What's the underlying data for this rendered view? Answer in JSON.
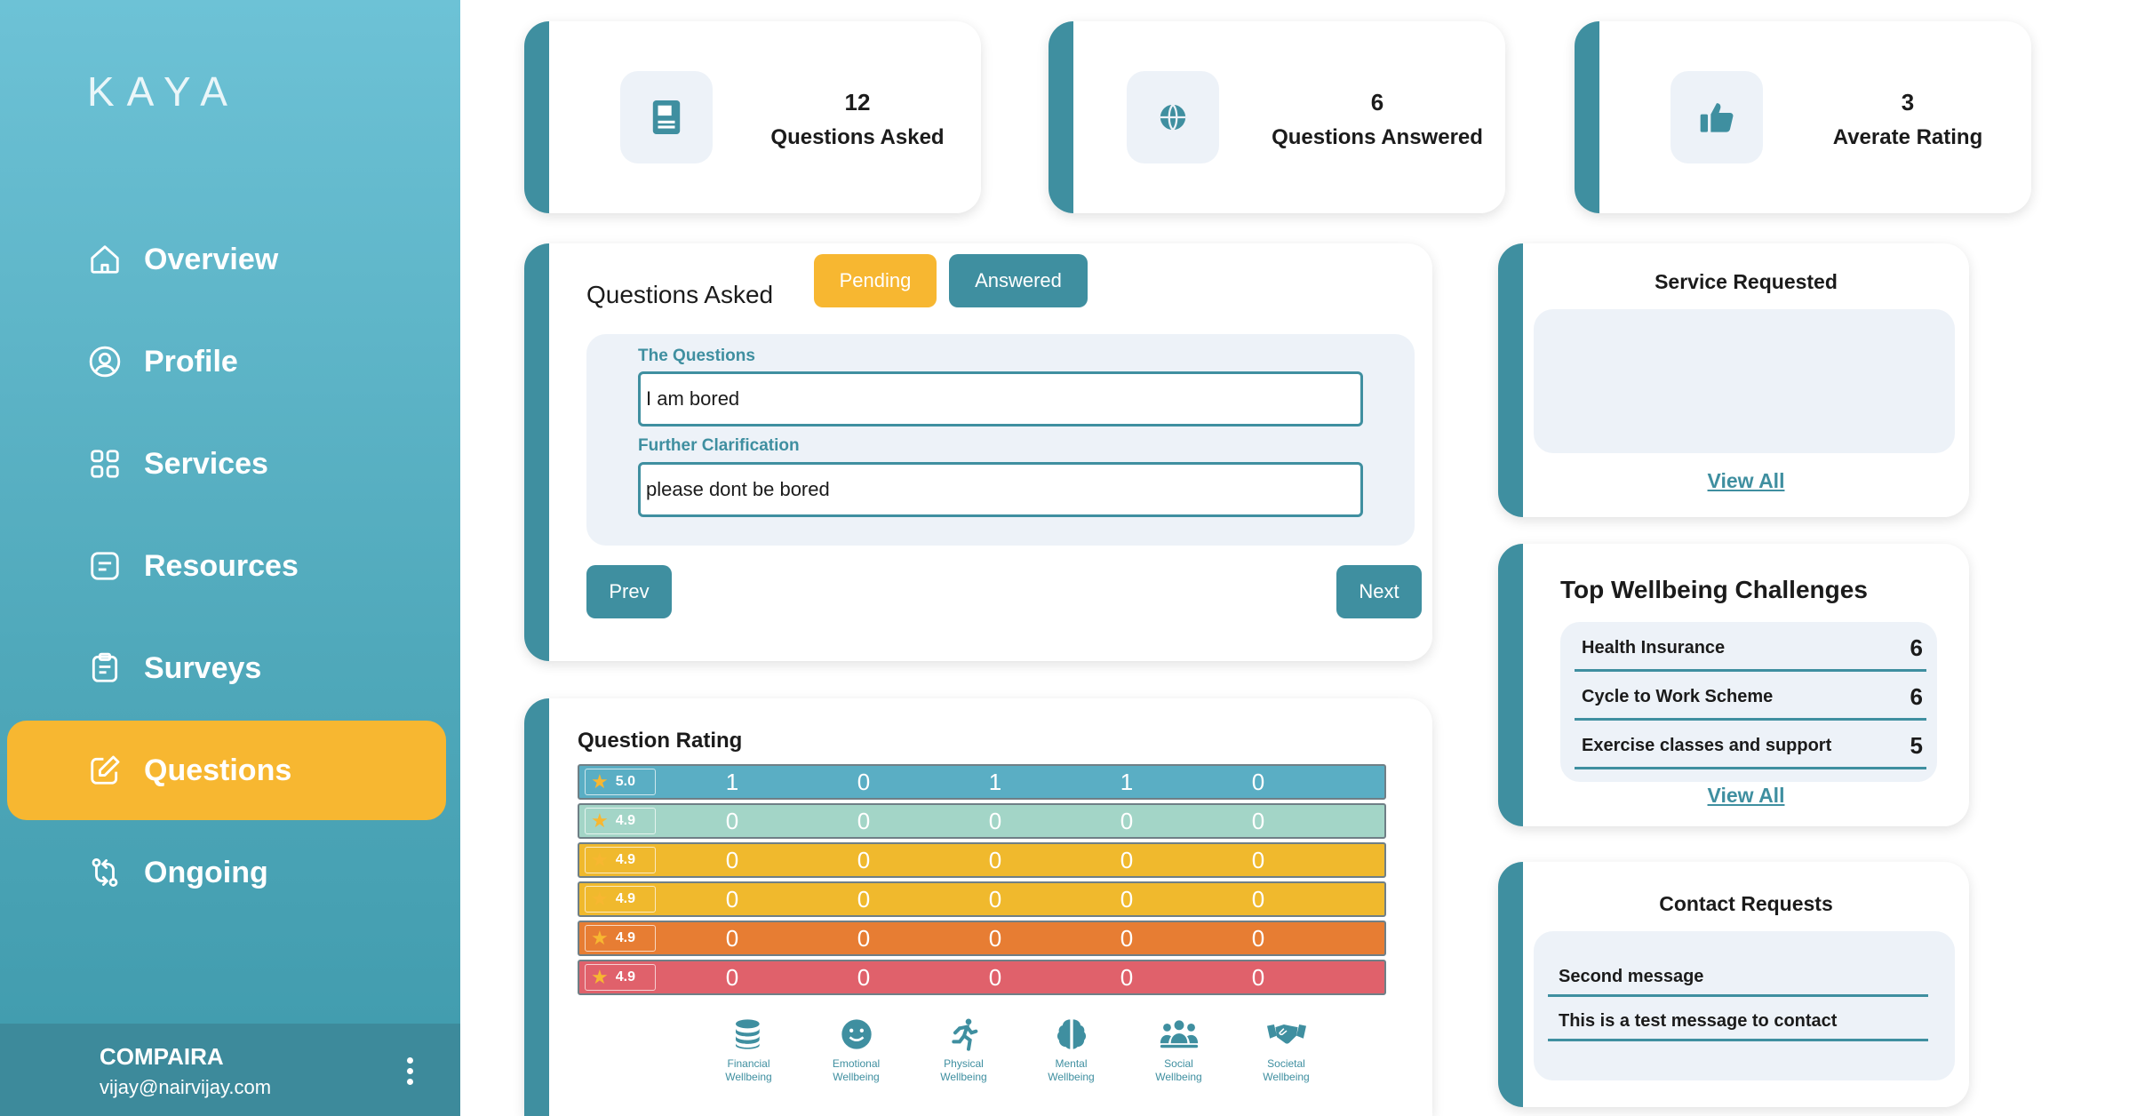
{
  "app": {
    "logo": "KAYA"
  },
  "sidebar": {
    "items": [
      {
        "label": "Overview",
        "icon": "home-icon"
      },
      {
        "label": "Profile",
        "icon": "user-circle-icon"
      },
      {
        "label": "Services",
        "icon": "grid-icon"
      },
      {
        "label": "Resources",
        "icon": "document-icon"
      },
      {
        "label": "Surveys",
        "icon": "clipboard-icon"
      },
      {
        "label": "Questions",
        "icon": "edit-icon",
        "active": true
      },
      {
        "label": "Ongoing",
        "icon": "swap-icon"
      }
    ],
    "footer": {
      "org": "COMPAIRA",
      "email": "vijay@nairvijay.com"
    }
  },
  "stats": [
    {
      "value": "12",
      "label": "Questions Asked",
      "icon": "notebook-icon"
    },
    {
      "value": "6",
      "label": "Questions Answered",
      "icon": "globe-icon"
    },
    {
      "value": "3",
      "label": "Averate Rating",
      "icon": "thumbs-up-icon"
    }
  ],
  "questions_panel": {
    "title": "Questions Asked",
    "pending_label": "Pending",
    "answered_label": "Answered",
    "question_label": "The Questions",
    "question_value": "I am bored",
    "clarification_label": "Further Clarification",
    "clarification_value": "please dont be bored",
    "prev_label": "Prev",
    "next_label": "Next"
  },
  "rating_panel": {
    "title": "Question Rating",
    "rows": [
      {
        "score": "5.0",
        "values": [
          "1",
          "0",
          "1",
          "1",
          "0"
        ],
        "color": "#5aaec4"
      },
      {
        "score": "4.9",
        "values": [
          "0",
          "0",
          "0",
          "0",
          "0"
        ],
        "color": "#a3d5c7"
      },
      {
        "score": "4.9",
        "values": [
          "0",
          "0",
          "0",
          "0",
          "0"
        ],
        "color": "#f0b92d"
      },
      {
        "score": "4.9",
        "values": [
          "0",
          "0",
          "0",
          "0",
          "0"
        ],
        "color": "#f0b92d"
      },
      {
        "score": "4.9",
        "values": [
          "0",
          "0",
          "0",
          "0",
          "0"
        ],
        "color": "#e77d33"
      },
      {
        "score": "4.9",
        "values": [
          "0",
          "0",
          "0",
          "0",
          "0"
        ],
        "color": "#e0616b"
      }
    ],
    "categories": [
      {
        "line1": "Financial",
        "line2": "Wellbeing",
        "icon": "coins-icon"
      },
      {
        "line1": "Emotional",
        "line2": "Wellbeing",
        "icon": "smiley-icon"
      },
      {
        "line1": "Physical",
        "line2": "Wellbeing",
        "icon": "runner-icon"
      },
      {
        "line1": "Mental",
        "line2": "Wellbeing",
        "icon": "brain-icon"
      },
      {
        "line1": "Social",
        "line2": "Wellbeing",
        "icon": "people-icon"
      },
      {
        "line1": "Societal",
        "line2": "Wellbeing",
        "icon": "handshake-icon"
      }
    ]
  },
  "service_requested": {
    "title": "Service Requested",
    "view_all": "View All"
  },
  "wellbeing": {
    "title": "Top Wellbeing Challenges",
    "items": [
      {
        "name": "Health Insurance",
        "count": "6"
      },
      {
        "name": "Cycle to Work Scheme",
        "count": "6"
      },
      {
        "name": "Exercise classes and support",
        "count": "5"
      }
    ],
    "view_all": "View All"
  },
  "contact_requests": {
    "title": "Contact Requests",
    "messages": [
      "Second message",
      "This is a test message to contact"
    ]
  },
  "colors": {
    "teal": "#3f8fa0",
    "accent": "#f7b731",
    "panel": "#edf2f8"
  }
}
